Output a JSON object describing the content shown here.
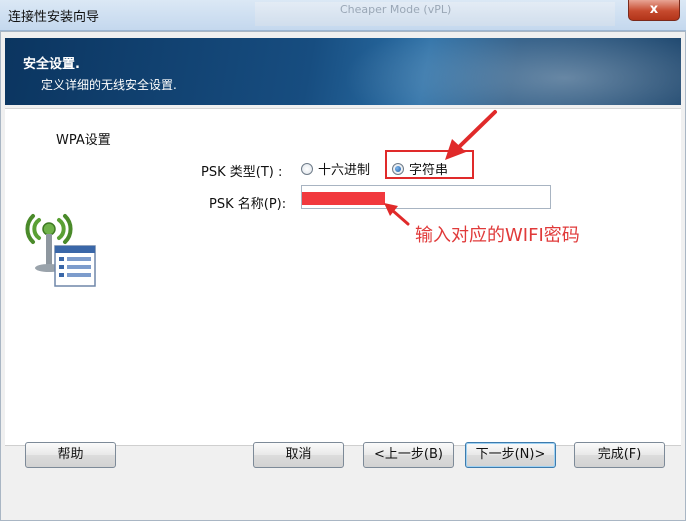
{
  "window": {
    "title": "连接性安装向导",
    "close_label": "x",
    "bg_text": "Cheaper Mode (vPL)"
  },
  "header": {
    "title": "安全设置.",
    "subtitle": "定义详细的无线安全设置."
  },
  "wpa": {
    "group_label": "WPA设置",
    "psk_type_label": "PSK 类型(T) :",
    "options": [
      "十六进制",
      "字符串"
    ],
    "selected_option": "字符串",
    "psk_name_label": "PSK 名称(P):",
    "psk_value": ""
  },
  "annotation": {
    "note": "输入对应的WIFI密码",
    "color": "#e03a3a"
  },
  "buttons": {
    "help": "帮助",
    "cancel": "取消",
    "back": "<上一步(B)",
    "next": "下一步(N)>",
    "finish": "完成(F)"
  },
  "icons": [
    "wifi-antenna-icon",
    "close-icon"
  ]
}
